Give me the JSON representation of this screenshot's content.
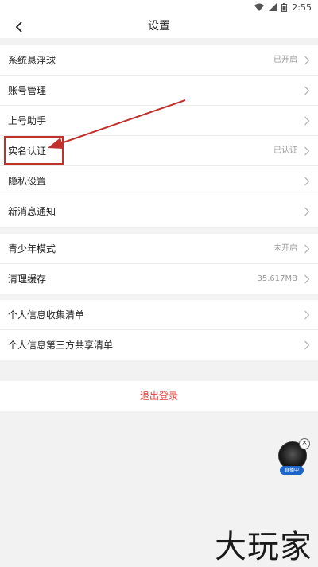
{
  "status_bar": {
    "time": "2:55"
  },
  "header": {
    "title": "设置",
    "back_icon": "chevron-left-icon"
  },
  "group1": [
    {
      "label": "系统悬浮球",
      "value": "已开启"
    },
    {
      "label": "账号管理",
      "value": ""
    },
    {
      "label": "上号助手",
      "value": ""
    },
    {
      "label": "实名认证",
      "value": "已认证"
    },
    {
      "label": "隐私设置",
      "value": ""
    },
    {
      "label": "新消息通知",
      "value": ""
    }
  ],
  "group2": [
    {
      "label": "青少年模式",
      "value": "未开启"
    },
    {
      "label": "清理缓存",
      "value": "35.617MB"
    }
  ],
  "group3": [
    {
      "label": "个人信息收集清单",
      "value": ""
    },
    {
      "label": "个人信息第三方共享清单",
      "value": ""
    }
  ],
  "logout_label": "退出登录",
  "float_widget": {
    "label": "直播中"
  },
  "watermark": "大玩家",
  "colors": {
    "logout": "#e0403a",
    "annotation": "#c0302c",
    "live_badge": "#1e63c7"
  }
}
